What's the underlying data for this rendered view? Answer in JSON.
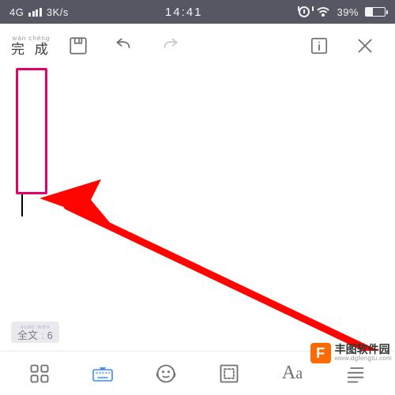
{
  "status_bar": {
    "network_type": "4G",
    "net_speed": "3K/s",
    "time": "14:41",
    "battery_pct": "39%"
  },
  "toolbar": {
    "done_pinyin": "wán chéng",
    "done_label": "完 成"
  },
  "word_count": {
    "pinyin": "xuán  wén",
    "label": "全文",
    "value": "6"
  },
  "bottom_bar": {
    "font_label_big": "A",
    "font_label_small": "a"
  },
  "watermark": {
    "logo_letter": "F",
    "title": "丰图软件园",
    "url": "www.dgfengtu.com"
  }
}
